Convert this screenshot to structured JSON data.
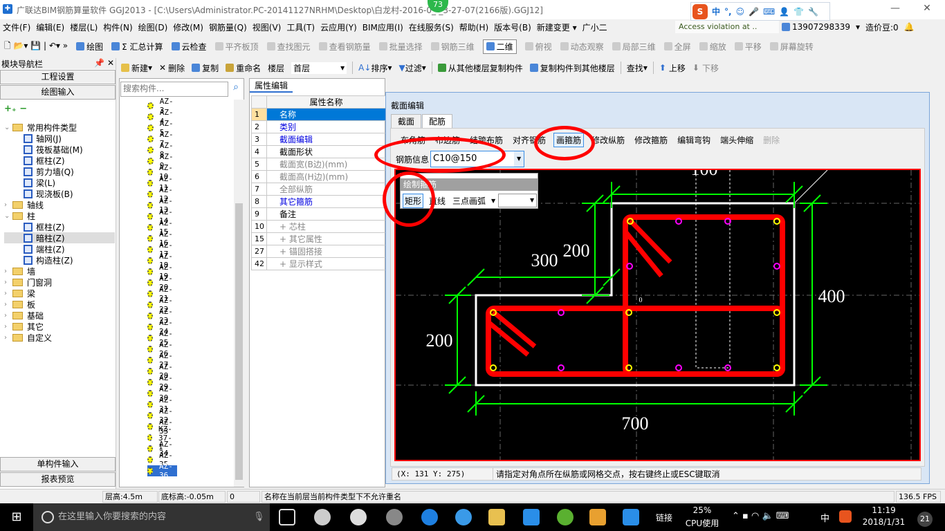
{
  "window": {
    "title": "广联达BIM钢筋算量软件 GGJ2013 - [C:\\Users\\Administrator.PC-20141127NRHM\\Desktop\\白龙村-2016-0_-_3-27-07(2166版).GGJ12]",
    "badge": "73"
  },
  "ime": {
    "items": [
      "中",
      "°,",
      "☺",
      "🎤",
      "⌨",
      "👤",
      "👕",
      "🔧"
    ]
  },
  "menu": [
    "文件(F)",
    "编辑(E)",
    "楼层(L)",
    "构件(N)",
    "绘图(D)",
    "修改(M)",
    "钢筋量(Q)",
    "视图(V)",
    "工具(T)",
    "云应用(Y)",
    "BIM应用(I)",
    "在线服务(S)",
    "帮助(H)",
    "版本号(B)",
    "新建变更 ▾",
    "广小二"
  ],
  "access_msg": "Access violation at ..",
  "account": {
    "phone": "13907298339",
    "beans": "造价豆:0"
  },
  "toolbar1": [
    "绘图",
    "Σ 汇总计算",
    "云检查",
    "平齐板顶",
    "查找图元",
    "查看钢筋量",
    "批量选择",
    "钢筋三维",
    "二维",
    "俯视",
    "动态观察",
    "局部三维",
    "全屏",
    "缩放",
    "平移",
    "屏幕旋转"
  ],
  "toolbar2": {
    "new": "新建",
    "delete": "删除",
    "copy": "复制",
    "rename": "重命名",
    "floor_label": "楼层",
    "floor_value": "首层",
    "sort": "排序",
    "filter": "过滤",
    "copy_from": "从其他楼层复制构件",
    "copy_to": "复制构件到其他楼层",
    "find": "查找",
    "up": "上移",
    "down": "下移"
  },
  "nav": {
    "title": "模块导航栏",
    "project_settings": "工程设置",
    "draw_input": "绘图输入",
    "single_input": "单构件输入",
    "report": "报表预览",
    "tree": [
      {
        "label": "常用构件类型",
        "level": 0,
        "folder": true,
        "open": true
      },
      {
        "label": "轴网(J)",
        "level": 1
      },
      {
        "label": "筏板基础(M)",
        "level": 1
      },
      {
        "label": "框柱(Z)",
        "level": 1
      },
      {
        "label": "剪力墙(Q)",
        "level": 1
      },
      {
        "label": "梁(L)",
        "level": 1
      },
      {
        "label": "现浇板(B)",
        "level": 1
      },
      {
        "label": "轴线",
        "level": 0,
        "folder": true
      },
      {
        "label": "柱",
        "level": 0,
        "folder": true,
        "open": true
      },
      {
        "label": "框柱(Z)",
        "level": 1
      },
      {
        "label": "暗柱(Z)",
        "level": 1,
        "selected": true
      },
      {
        "label": "端柱(Z)",
        "level": 1
      },
      {
        "label": "构造柱(Z)",
        "level": 1
      },
      {
        "label": "墙",
        "level": 0,
        "folder": true
      },
      {
        "label": "门窗洞",
        "level": 0,
        "folder": true
      },
      {
        "label": "梁",
        "level": 0,
        "folder": true
      },
      {
        "label": "板",
        "level": 0,
        "folder": true
      },
      {
        "label": "基础",
        "level": 0,
        "folder": true
      },
      {
        "label": "其它",
        "level": 0,
        "folder": true
      },
      {
        "label": "自定义",
        "level": 0,
        "folder": true
      }
    ]
  },
  "components": {
    "search_placeholder": "搜索构件...",
    "items": [
      "AZ-3",
      "AZ-4",
      "AZ-5",
      "AZ-7",
      "AZ-8",
      "AZ-9",
      "AZ-10",
      "AZ-11",
      "AZ-12",
      "AZ-13",
      "AZ-14",
      "AZ-15",
      "AZ-16",
      "AZ-17",
      "AZ-18",
      "AZ-19",
      "AZ-20",
      "AZ-21",
      "AZ-22",
      "AZ-23",
      "AZ-24",
      "AZ-25",
      "AZ-26",
      "AZ-27",
      "AZ-28",
      "AZ-29",
      "AZ-30",
      "AZ-31",
      "AZ-32",
      "AZ-33",
      "KZ-37-1",
      "AZ-34",
      "AZ-35",
      "AZ-36"
    ],
    "selected": "AZ-36"
  },
  "properties": {
    "tab": "属性编辑",
    "header": "属性名称",
    "rows": [
      {
        "n": "1",
        "label": "名称",
        "style": "sel"
      },
      {
        "n": "2",
        "label": "类别",
        "style": "blue"
      },
      {
        "n": "3",
        "label": "截面编辑",
        "style": "blue"
      },
      {
        "n": "4",
        "label": "截面形状",
        "style": ""
      },
      {
        "n": "5",
        "label": "截面宽(B边)(mm)",
        "style": "gray"
      },
      {
        "n": "6",
        "label": "截面高(H边)(mm)",
        "style": "gray"
      },
      {
        "n": "7",
        "label": "全部纵筋",
        "style": "gray"
      },
      {
        "n": "8",
        "label": "其它箍筋",
        "style": "blue"
      },
      {
        "n": "9",
        "label": "备注",
        "style": ""
      },
      {
        "n": "10",
        "label": "+ 芯柱",
        "style": "gray"
      },
      {
        "n": "15",
        "label": "+ 其它属性",
        "style": "gray"
      },
      {
        "n": "27",
        "label": "+ 锚固搭接",
        "style": "gray"
      },
      {
        "n": "42",
        "label": "+ 显示样式",
        "style": "gray"
      }
    ]
  },
  "section_editor": {
    "title": "截面编辑",
    "tabs": [
      "截面",
      "配筋"
    ],
    "active_tab": "配筋",
    "tools": [
      "布角筋",
      "布边筋",
      "结跨布筋",
      "对齐钢筋",
      "画箍筋",
      "修改纵筋",
      "修改箍筋",
      "编辑弯钩",
      "端头伸缩",
      "删除"
    ],
    "active_tool": "画箍筋",
    "rebar_label": "钢筋信息",
    "rebar_value": "C10@150",
    "draw_panel": {
      "title": "绘制箍筋",
      "rect": "矩形",
      "line": "直线",
      "arc": "三点画弧"
    },
    "dims": {
      "top": "100",
      "left_upper": "200",
      "step": "300",
      "right": "400",
      "left_lower": "200",
      "bottom": "700",
      "origin": "0"
    },
    "coords": "(X: 131 Y: 275)",
    "prompt": "请指定对角点所在纵筋或网格交点，按右键终止或ESC键取消",
    "colors": {
      "stirrup": "#ff0000",
      "dimension": "#00ff00",
      "outline": "#ffffff",
      "corner_bar": "#ffff00",
      "edge_bar": "#ff00ff"
    }
  },
  "status": {
    "floor_height": "层高:4.5m",
    "base_elev": "底标高:-0.05m",
    "zero": "0",
    "msg": "名称在当前层当前构件类型下不允许重名",
    "fps": "136.5 FPS"
  },
  "taskbar": {
    "search": "在这里输入你要搜索的内容",
    "link": "链接",
    "cpu": "25%",
    "cpu_label": "CPU使用",
    "lang": "中",
    "time": "11:19",
    "date": "2018/1/31",
    "notif": "21"
  }
}
